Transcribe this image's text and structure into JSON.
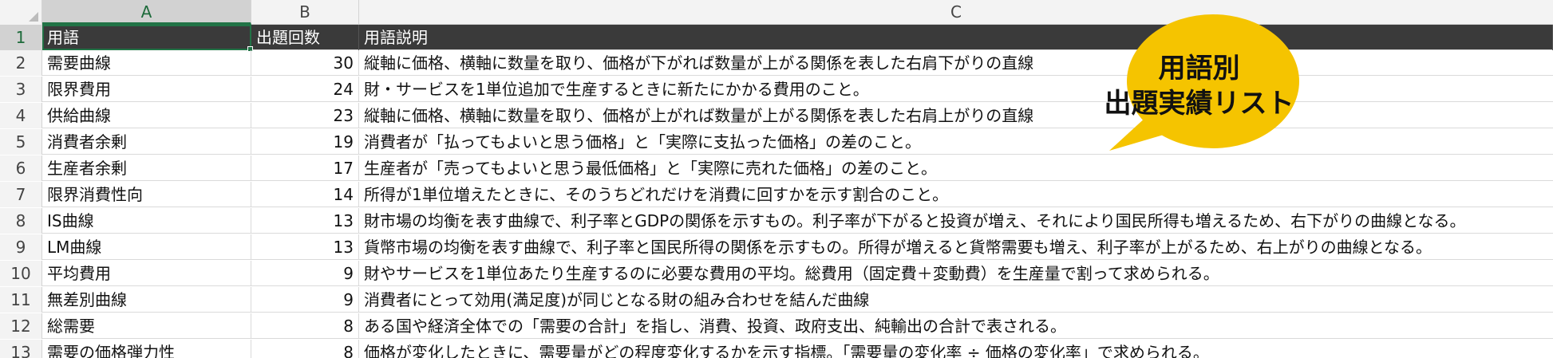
{
  "columns": [
    "A",
    "B",
    "C"
  ],
  "header": {
    "term": "用語",
    "count": "出題回数",
    "desc": "用語説明"
  },
  "rows": [
    {
      "num": "2",
      "term": "需要曲線",
      "count": "30",
      "desc": "縦軸に価格、横軸に数量を取り、価格が下がれば数量が上がる関係を表した右肩下がりの直線"
    },
    {
      "num": "3",
      "term": "限界費用",
      "count": "24",
      "desc": "財・サービスを1単位追加で生産するときに新たにかかる費用のこと。"
    },
    {
      "num": "4",
      "term": "供給曲線",
      "count": "23",
      "desc": "縦軸に価格、横軸に数量を取り、価格が上がれば数量が上がる関係を表した右肩上がりの直線"
    },
    {
      "num": "5",
      "term": "消費者余剰",
      "count": "19",
      "desc": "消費者が「払ってもよいと思う価格」と「実際に支払った価格」の差のこと。"
    },
    {
      "num": "6",
      "term": "生産者余剰",
      "count": "17",
      "desc": "生産者が「売ってもよいと思う最低価格」と「実際に売れた価格」の差のこと。"
    },
    {
      "num": "7",
      "term": "限界消費性向",
      "count": "14",
      "desc": "所得が1単位増えたときに、そのうちどれだけを消費に回すかを示す割合のこと。"
    },
    {
      "num": "8",
      "term": "IS曲線",
      "count": "13",
      "desc": "財市場の均衡を表す曲線で、利子率とGDPの関係を示すもの。利子率が下がると投資が増え、それにより国民所得も増えるため、右下がりの曲線となる。"
    },
    {
      "num": "9",
      "term": "LM曲線",
      "count": "13",
      "desc": "貨幣市場の均衡を表す曲線で、利子率と国民所得の関係を示すもの。所得が増えると貨幣需要も増え、利子率が上がるため、右上がりの曲線となる。"
    },
    {
      "num": "10",
      "term": "平均費用",
      "count": "9",
      "desc": "財やサービスを1単位あたり生産するのに必要な費用の平均。総費用（固定費＋変動費）を生産量で割って求められる。"
    },
    {
      "num": "11",
      "term": "無差別曲線",
      "count": "9",
      "desc": "消費者にとって効用(満足度)が同じとなる財の組み合わせを結んだ曲線"
    },
    {
      "num": "12",
      "term": "総需要",
      "count": "8",
      "desc": "ある国や経済全体での「需要の合計」を指し、消費、投資、政府支出、純輸出の合計で表される。"
    },
    {
      "num": "13",
      "term": "需要の価格弾力性",
      "count": "8",
      "desc": "価格が変化したときに、需要量がどの程度変化するかを示す指標。「需要量の変化率 ÷ 価格の変化率」で求められる。"
    }
  ],
  "callout": {
    "line1": "用語別",
    "line2": "出題実績リスト",
    "color": "#f5c400"
  }
}
